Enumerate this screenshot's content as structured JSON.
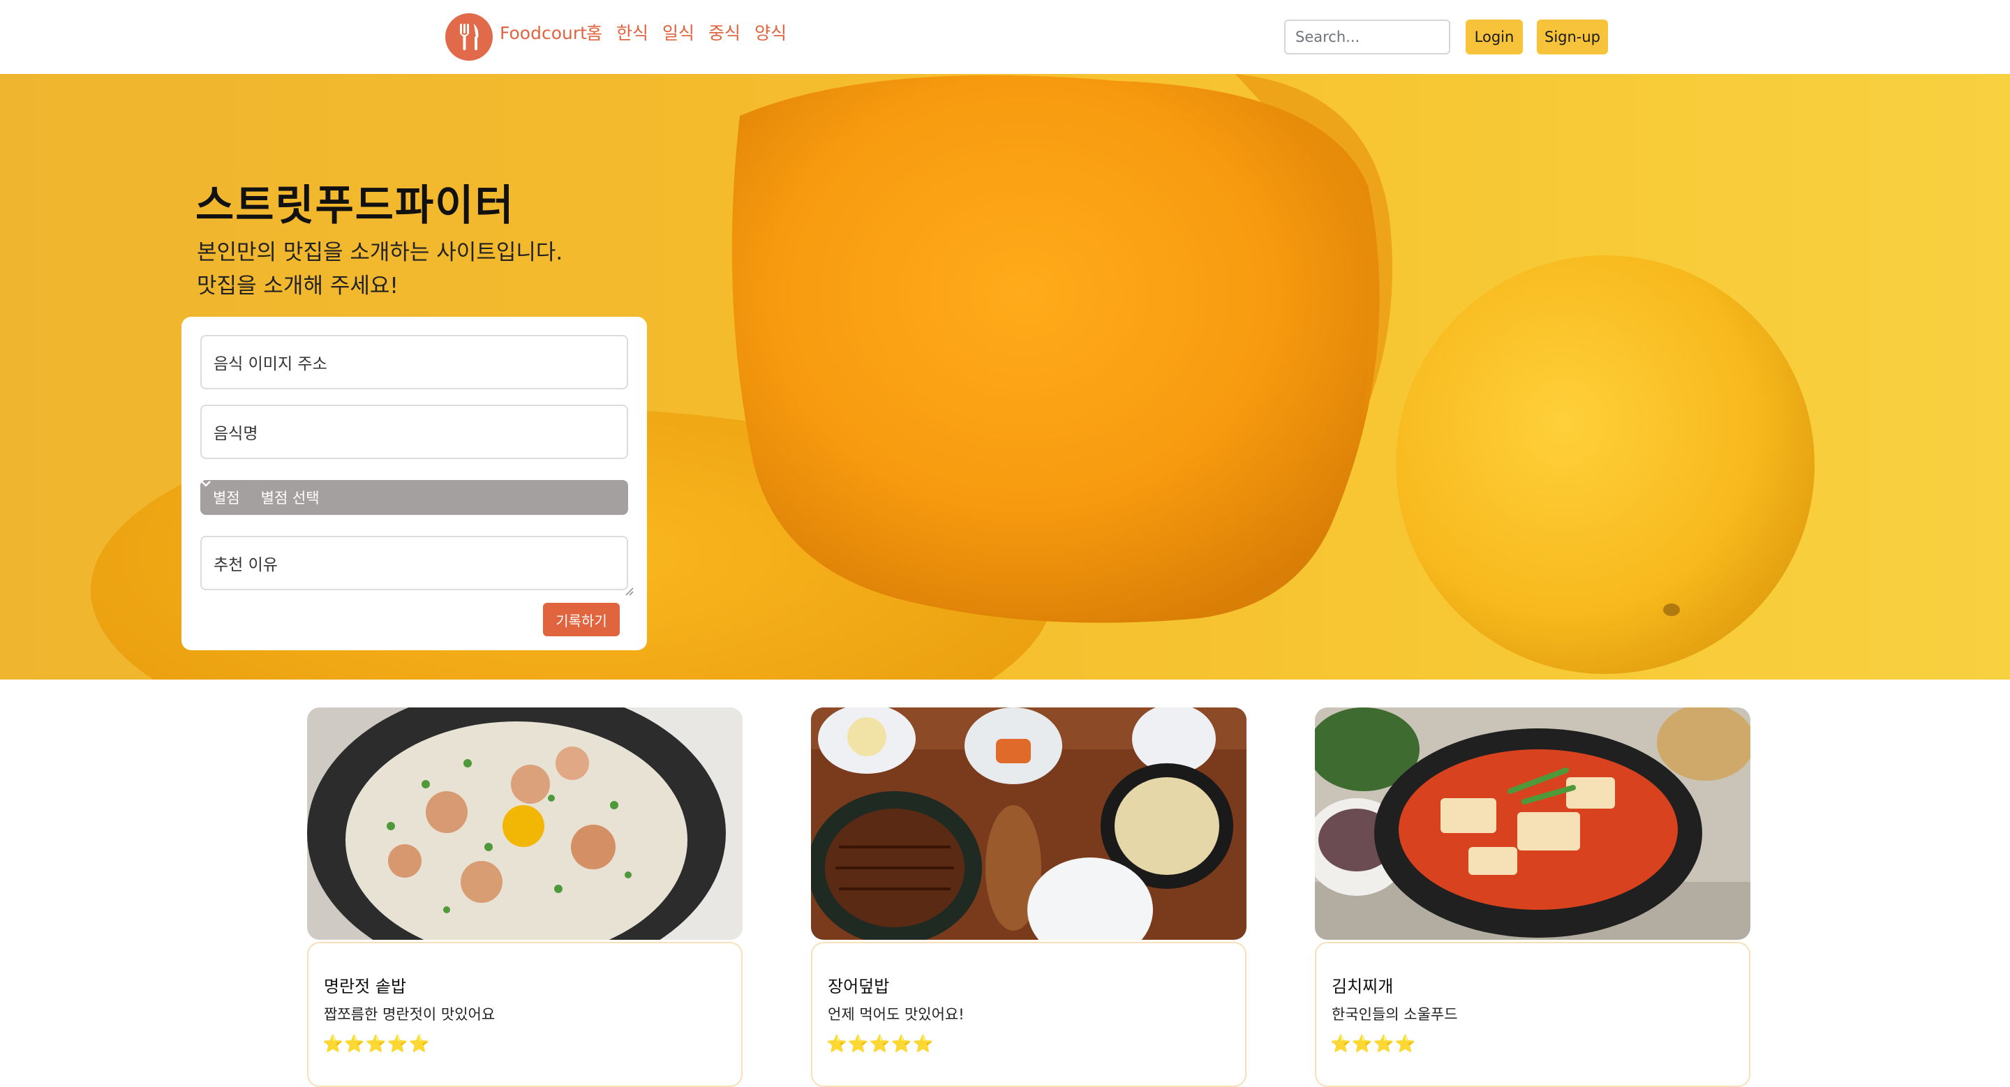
{
  "nav": {
    "brand": "Foodcourt",
    "links": [
      "홈",
      "한식",
      "일식",
      "중식",
      "양식"
    ],
    "search_placeholder": "Search...",
    "login_label": "Login",
    "signup_label": "Sign-up"
  },
  "hero": {
    "title": "스트릿푸드파이터",
    "desc_line1": "본인만의 맛집을 소개하는 사이트입니다.",
    "desc_line2": "맛집을 소개해 주세요!"
  },
  "form": {
    "image_placeholder": "음식 이미지 주소",
    "name_placeholder": "음식명",
    "rating_label": "별점",
    "rating_value": "별점 선택",
    "reason_placeholder": "추천 이유",
    "submit_label": "기록하기"
  },
  "cards": [
    {
      "title": "명란젓 솥밥",
      "text": "짭쪼름한 명란젓이 맛있어요",
      "stars": "⭐⭐⭐⭐⭐",
      "rating": 5
    },
    {
      "title": "장어덮밥",
      "text": "언제 먹어도 맛있어요!",
      "stars": "⭐⭐⭐⭐⭐",
      "rating": 5
    },
    {
      "title": "김치찌개",
      "text": "한국인들의 소울푸드",
      "stars": "⭐⭐⭐⭐",
      "rating": 4
    }
  ],
  "colors": {
    "accent": "#e0653f",
    "button_yellow": "#f7c33b",
    "select_bg": "#a5a0a0"
  }
}
